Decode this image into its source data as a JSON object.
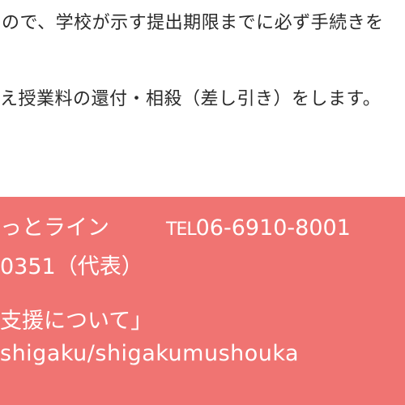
{
  "document": {
    "line1": "ので、学校が示す提出期限までに必ず手続きを",
    "line2": "え授業料の還付・相殺（差し引き）をします。"
  },
  "contact": {
    "hotline_name": "っとライン",
    "tel_prefix": "TEL",
    "tel_number": "06-6910-8001",
    "main_number": "0351（代表）",
    "page_title": "支援について」",
    "url": "shigaku/shigakumushouka"
  },
  "colors": {
    "box_background": "#f07472",
    "box_text": "#ffffff",
    "body_text": "#2a2a2a"
  }
}
